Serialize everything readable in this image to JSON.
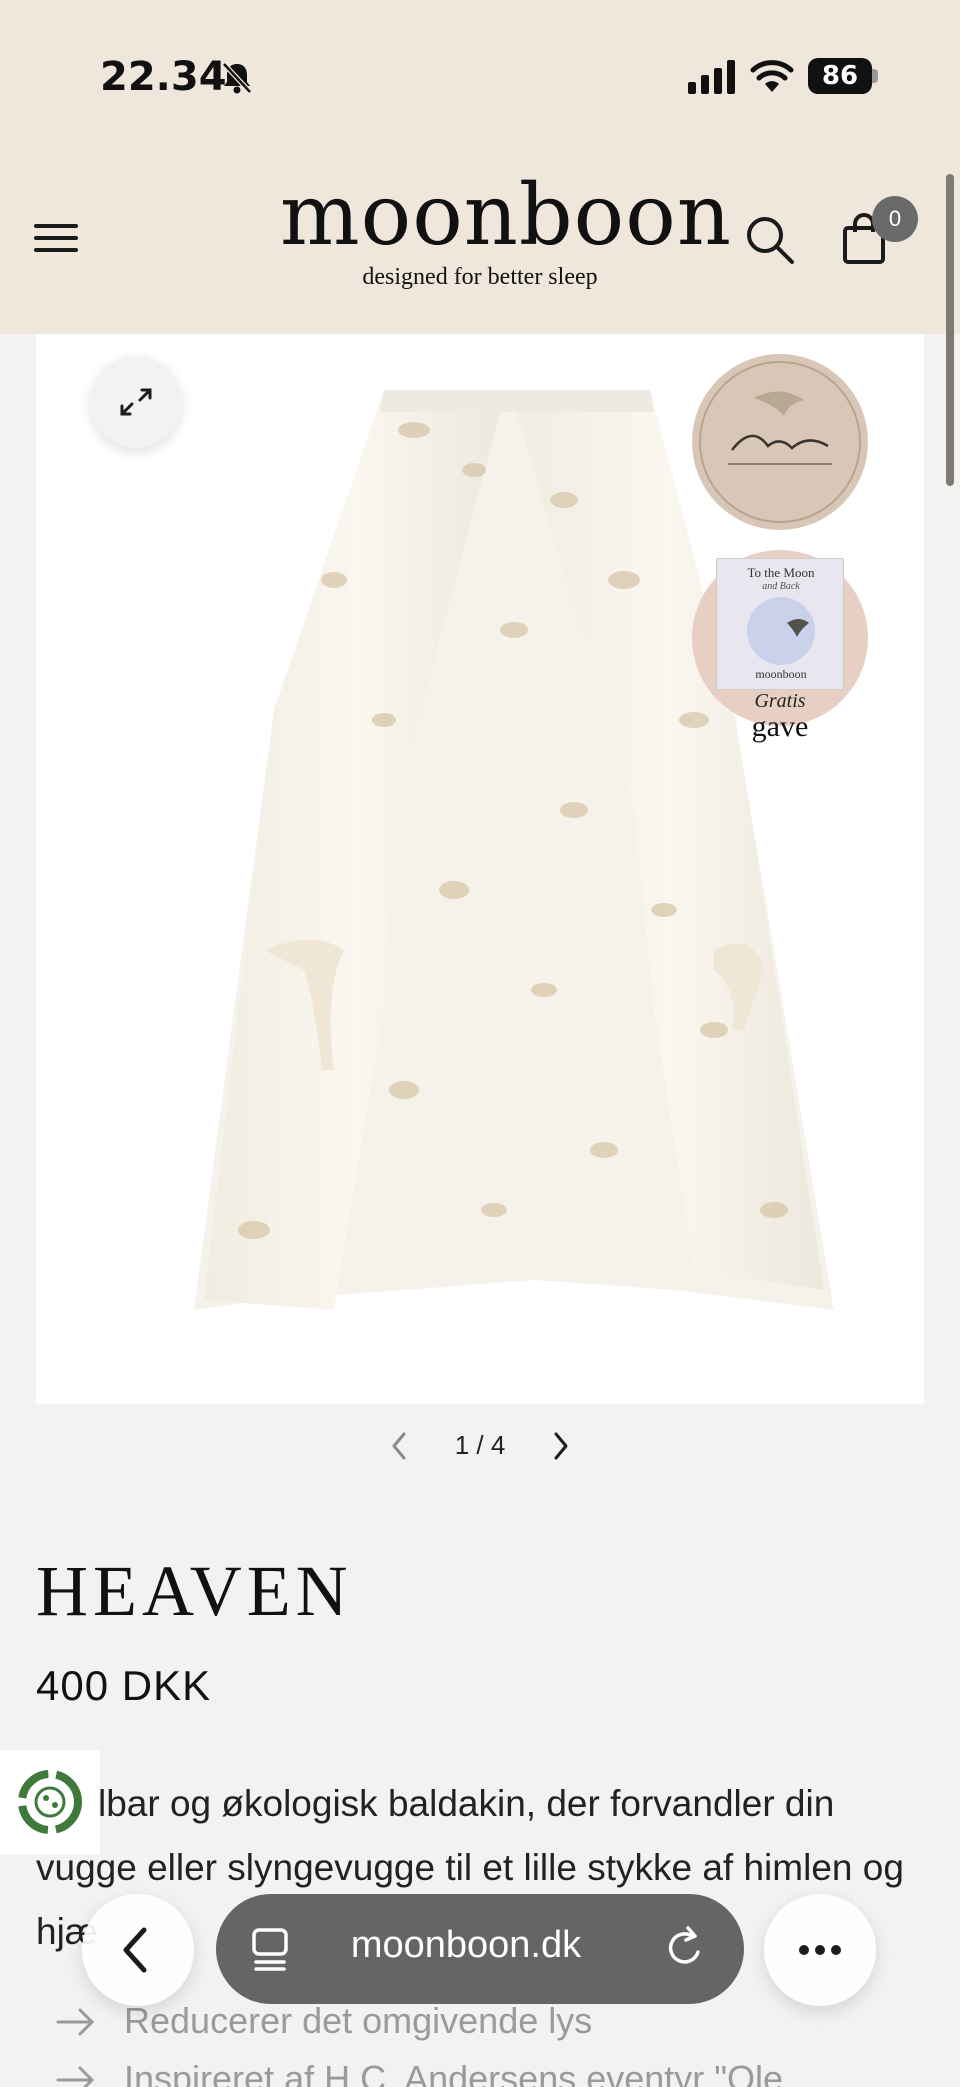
{
  "status_bar": {
    "time": "22.34",
    "battery": "86"
  },
  "header": {
    "logo": "moonboon",
    "tagline": "designed for better sleep",
    "cart_count": "0"
  },
  "gallery": {
    "book_title": "To the Moon",
    "book_subtitle": "and Back",
    "book_brand": "moonboon",
    "gift_label_top": "Gratis",
    "gift_label_bottom": "gave",
    "pager": "1 / 4"
  },
  "product": {
    "title": "HEAVEN",
    "price": "400 DKK",
    "description_lines": [
      "lbar og økologisk baldakin, der forvandler din",
      "vugge eller slyngevugge til et lille stykke af himlen og",
      "hjæ"
    ],
    "bullets": [
      "Reducerer det omgivende lys",
      "Inspireret af H.C. Andersens eventyr \"Ole"
    ]
  },
  "browser": {
    "domain": "moonboon.dk"
  },
  "colors": {
    "header_bg": "#efe7dc",
    "page_bg": "#f3f2f1",
    "badge_gray": "#6a6a6a",
    "url_bar": "#5f5f5f"
  }
}
